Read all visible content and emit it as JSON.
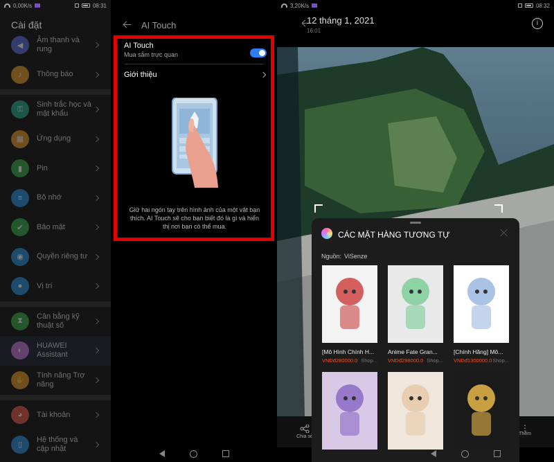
{
  "panel1": {
    "status": {
      "speed": "0,00K/s",
      "time": "08:31"
    },
    "title": "Cài đặt",
    "items": [
      {
        "label": "Âm thanh và rung",
        "color": "#5b6bd9",
        "icon": "speaker-icon"
      },
      {
        "label": "Thông báo",
        "color": "#e09a2a",
        "icon": "bell-icon"
      },
      {
        "label": "Sinh trắc học và mật khẩu",
        "color": "#25a98a",
        "icon": "key-icon"
      },
      {
        "label": "Ứng dụng",
        "color": "#e0952a",
        "icon": "apps-icon"
      },
      {
        "label": "Pin",
        "color": "#3aa84a",
        "icon": "battery-icon"
      },
      {
        "label": "Bộ nhớ",
        "color": "#2b8fd6",
        "icon": "storage-icon"
      },
      {
        "label": "Bảo mật",
        "color": "#3aa84a",
        "icon": "shield-icon"
      },
      {
        "label": "Quyền riêng tư",
        "color": "#2b8fd6",
        "icon": "privacy-icon"
      },
      {
        "label": "Vị trí",
        "color": "#2b8fd6",
        "icon": "location-icon"
      },
      {
        "label": "Cân bằng kỹ thuật số",
        "color": "#3aa84a",
        "icon": "hourglass-icon"
      },
      {
        "label": "HUAWEI Assistant",
        "color": "#c478d8",
        "icon": "assistant-icon"
      },
      {
        "label": "Tính năng Trợ năng",
        "color": "#e0952a",
        "icon": "hand-icon"
      },
      {
        "label": "Tài khoản",
        "color": "#e05a4a",
        "icon": "account-icon"
      },
      {
        "label": "Hệ thống và cập nhật",
        "color": "#2b8fd6",
        "icon": "phone-icon"
      }
    ]
  },
  "panel2": {
    "title": "AI Touch",
    "toggle": {
      "label": "AI Touch",
      "sublabel": "Mua sắm trực quan",
      "on": true
    },
    "intro": "Giới thiệu",
    "description": "Giữ hai ngón tay trên hình ảnh của một vật bạn thích. AI Touch sẽ cho bạn biết đó là gì và hiển thị nơi bạn có thể mua."
  },
  "panel3": {
    "status": {
      "speed": "3,20K/s",
      "time": "08:32"
    },
    "date": "12 tháng 1, 2021",
    "time": "16:01",
    "sheet": {
      "title": "CÁC MẶT HÀNG TƯƠNG TỰ",
      "source_label": "Nguồn:",
      "source_value": "ViSenze",
      "products": [
        {
          "name": "[Mô Hình Chính H...",
          "price": "VNDđ280000.0",
          "shop": "Shop..."
        },
        {
          "name": "Anime Fate Gran...",
          "price": "VNDđ298000.0",
          "shop": "Shop..."
        },
        {
          "name": "[Chính Hãng] Mô...",
          "price": "VNDđ1300000.0",
          "shop": "Shop..."
        },
        {
          "name": "",
          "price": "",
          "shop": ""
        },
        {
          "name": "",
          "price": "",
          "shop": ""
        },
        {
          "name": "",
          "price": "",
          "shop": ""
        }
      ]
    },
    "share_label": "Chia sẻ",
    "more_label": "Thêm"
  }
}
